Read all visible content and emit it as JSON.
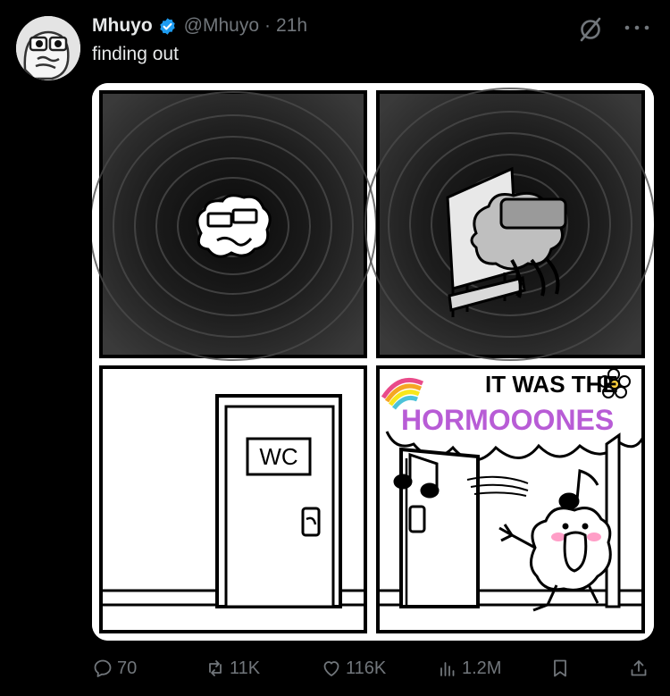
{
  "post": {
    "author_name": "Mhuyo",
    "handle": "@Mhuyo",
    "separator": "·",
    "time": "21h",
    "text": "finding out",
    "comic_caption_line1": "IT WAS THE",
    "comic_caption_line2": "HORMOOONES",
    "door_sign": "WC"
  },
  "metrics": {
    "replies": "70",
    "reposts": "11K",
    "likes": "116K",
    "views": "1.2M"
  },
  "icons": [
    "avatar",
    "verified-badge-icon",
    "grok-icon",
    "more-icon",
    "reply-icon",
    "repost-icon",
    "like-icon",
    "views-icon",
    "bookmark-icon",
    "share-icon"
  ],
  "colors": {
    "background": "#000000",
    "text": "#e7e9ea",
    "muted": "#71767b",
    "verified": "#1d9bf0"
  }
}
